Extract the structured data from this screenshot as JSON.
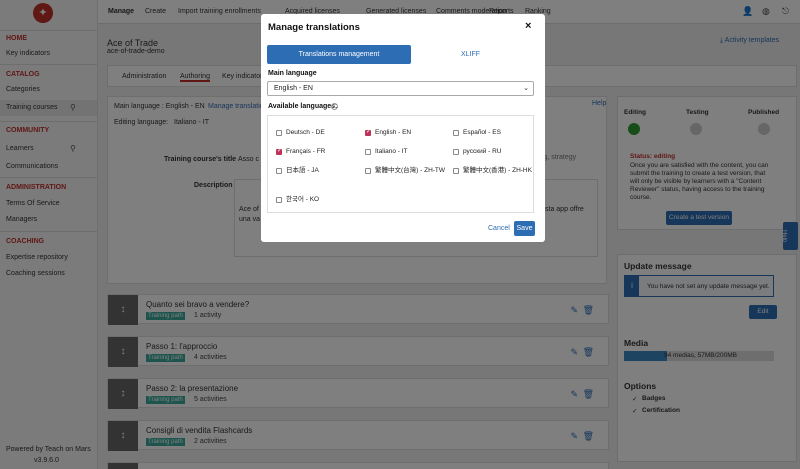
{
  "sidebar": {
    "home": "HOME",
    "key_indicators": "Key indicators",
    "catalog": "CATALOG",
    "categories": "Categories",
    "training_courses": "Training courses",
    "community": "COMMUNITY",
    "learners": "Learners",
    "communications": "Communications",
    "administration": "ADMINISTRATION",
    "terms": "Terms Of Service",
    "managers": "Managers",
    "coaching": "COACHING",
    "expertise": "Expertise repository",
    "coaching_sessions": "Coaching sessions",
    "powered_by": "Powered by Teach on Mars",
    "version": "v3.9.6.0"
  },
  "topnav": {
    "items": [
      "Manage",
      "Create",
      "Import training enrollments",
      "Acquired licenses",
      "Generated licenses",
      "Comments moderation",
      "Reports",
      "Ranking"
    ],
    "icons": [
      "user-icon",
      "globe-icon",
      "logout-icon"
    ]
  },
  "page": {
    "title": "Ace of Trade",
    "slug": "ace-of-trade-demo",
    "activity_templates": "Activity templates",
    "tabs": [
      "Administration",
      "Authoring",
      "Key indicators"
    ],
    "main_language": "Main language : English - EN",
    "manage_translations": "Manage translations",
    "help": "Help",
    "editing_language_label": "Editing language:",
    "editing_language_value": "Italiano - IT",
    "course_title_label": "Training course's title",
    "course_title_value": "Asso c",
    "tags_value": "ing, strategy",
    "description_label": "Description",
    "description_text_1": "Ace of",
    "description_text_2": "una va",
    "description_text_3": "sta app offre"
  },
  "status": {
    "editing": "Editing",
    "testing": "Testing",
    "published": "Published",
    "status_title": "Status: editing",
    "status_text": "Once you are satisfied with the content, you can submit the training to create a test version, that will only be visible by learners with a \"Content Reviewer\" status, having access to the training course.",
    "create_test_btn": "Create a test version",
    "update_title": "Update message",
    "update_text": "You have not set any update message yet.",
    "edit_btn": "Edit",
    "media_title": "Media",
    "media_text": "94 medias, 57MB/200MB",
    "media_fraction": 0.285,
    "options_title": "Options",
    "badges": "Badges",
    "certification": "Certification",
    "side_tab": "Help"
  },
  "tracks": [
    {
      "title": "Quanto sei bravo a vendere?",
      "badge": "Training path",
      "activities": "1 activity"
    },
    {
      "title": "Passo 1: l'approccio",
      "badge": "Training path",
      "activities": "4 activities"
    },
    {
      "title": "Passo 2: la presentazione",
      "badge": "Training path",
      "activities": "5 activities"
    },
    {
      "title": "Consigli di vendita Flashcards",
      "badge": "Training path",
      "activities": "2 activities"
    }
  ],
  "modal": {
    "title": "Manage translations",
    "close": "×",
    "tab_translations": "Translations management",
    "tab_xliff": "XLIFF",
    "main_language_label": "Main language",
    "main_language_value": "English - EN",
    "available_label": "Available languages:",
    "languages": [
      {
        "label": "Deutsch - DE",
        "checked": false
      },
      {
        "label": "English - EN",
        "checked": true
      },
      {
        "label": "Español - ES",
        "checked": false
      },
      {
        "label": "Français - FR",
        "checked": true
      },
      {
        "label": "Italiano - IT",
        "checked": false
      },
      {
        "label": "русский - RU",
        "checked": false
      },
      {
        "label": "日本語 - JA",
        "checked": false
      },
      {
        "label": "繁體中文(台灣) - ZH-TW",
        "checked": false
      },
      {
        "label": "繁體中文(香港) - ZH-HK",
        "checked": false
      },
      {
        "label": "한국어 - KO",
        "checked": false
      }
    ],
    "cancel": "Cancel",
    "save": "Save"
  }
}
